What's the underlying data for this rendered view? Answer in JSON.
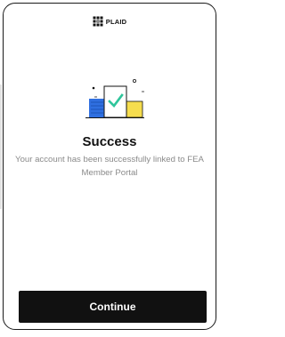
{
  "brand": {
    "name": "PLAID",
    "icon": "plaid-logo-icon"
  },
  "illustration": {
    "icon": "success-checkmark-illustration",
    "colors": {
      "blue": "#2f6fe0",
      "yellow": "#f6dd4e",
      "green": "#2fc59b"
    }
  },
  "success": {
    "title": "Success",
    "message": "Your account has been successfully linked to FEA Member Portal"
  },
  "actions": {
    "continue_label": "Continue"
  },
  "colors": {
    "button_bg": "#111111",
    "button_text": "#ffffff",
    "message_text": "#8a8a8a"
  }
}
